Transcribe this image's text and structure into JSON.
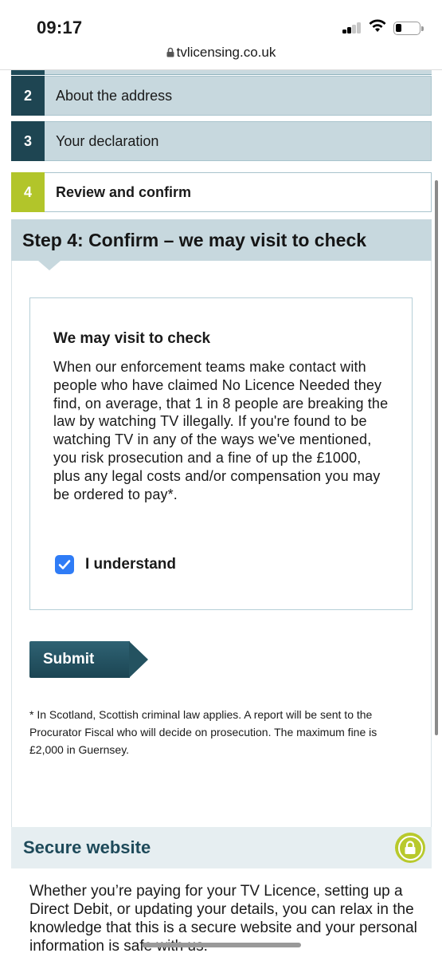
{
  "status_bar": {
    "time": "09:17",
    "signal_icon": "cellular-signal-icon",
    "wifi_icon": "wifi-icon",
    "battery_icon": "battery-low-icon"
  },
  "browser": {
    "url": "tvlicensing.co.uk",
    "lock_icon": "padlock-icon"
  },
  "steps": [
    {
      "number": "2",
      "label": "About the address",
      "state": "completed"
    },
    {
      "number": "3",
      "label": "Your declaration",
      "state": "completed"
    },
    {
      "number": "4",
      "label": "Review and confirm",
      "state": "active"
    }
  ],
  "main": {
    "heading": "Step 4: Confirm – we may visit to check",
    "info_box": {
      "title": "We may visit to check",
      "text": "When our enforcement teams make contact with people who have claimed No Licence Needed they find, on average, that 1 in 8 people are breaking the law by watching TV illegally. If you're found to be watching TV in any of the ways we've mentioned, you risk prosecution and a fine of up the £1000, plus any legal costs and/or compensation you may be ordered to pay*.",
      "checkbox_label": "I understand",
      "checkbox_checked": true
    },
    "submit_label": "Submit",
    "footnote": "* In Scotland, Scottish criminal law applies. A report will be sent to the Procurator Fiscal who will decide on prosecution. The maximum fine is £2,000 in Guernsey."
  },
  "secure": {
    "title": "Secure website",
    "text": "Whether you’re paying for your TV Licence, setting up a Direct Debit, or updating your details, you can relax in the knowledge that this is a secure website and your personal information is safe with us.",
    "icon": "padlock-icon"
  },
  "colors": {
    "step_dark": "#1e4552",
    "step_active": "#b2c52a",
    "step_light": "#c7d8de",
    "checkbox_blue": "#2f7cf6",
    "heading_teal": "#1e4a5a"
  }
}
